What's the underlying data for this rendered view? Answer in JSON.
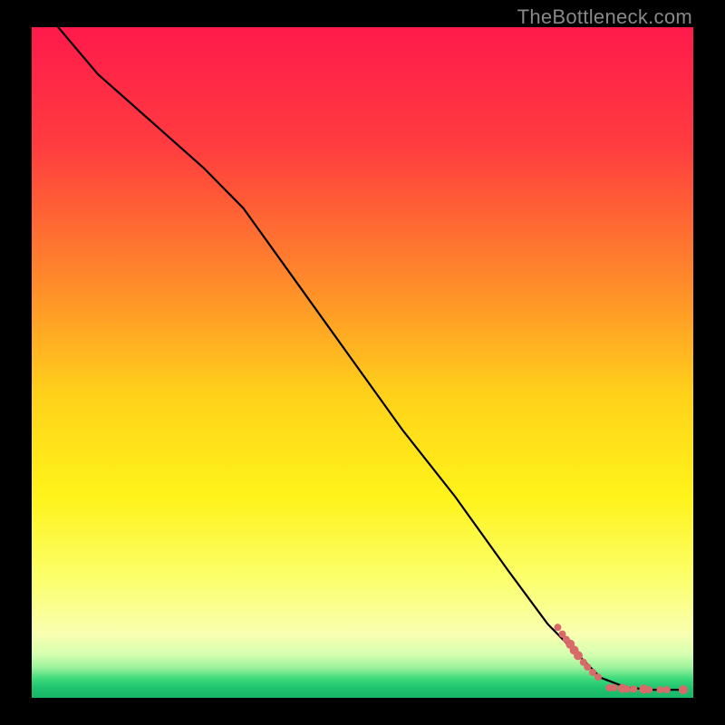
{
  "watermark": "TheBottleneck.com",
  "chart_data": {
    "type": "line",
    "title": "",
    "xlabel": "",
    "ylabel": "",
    "xlim": [
      0,
      100
    ],
    "ylim": [
      0,
      100
    ],
    "background_gradient": {
      "stops": [
        {
          "offset": 0.0,
          "color": "#ff1a4b"
        },
        {
          "offset": 0.18,
          "color": "#ff3d3f"
        },
        {
          "offset": 0.38,
          "color": "#ff8a2a"
        },
        {
          "offset": 0.55,
          "color": "#ffd21a"
        },
        {
          "offset": 0.7,
          "color": "#fff31a"
        },
        {
          "offset": 0.82,
          "color": "#fbff6a"
        },
        {
          "offset": 0.905,
          "color": "#f9ffb0"
        },
        {
          "offset": 0.935,
          "color": "#d6ffb0"
        },
        {
          "offset": 0.955,
          "color": "#9cf29c"
        },
        {
          "offset": 0.972,
          "color": "#3bd97a"
        },
        {
          "offset": 0.985,
          "color": "#1fc46f"
        },
        {
          "offset": 1.0,
          "color": "#17b768"
        }
      ]
    },
    "series": [
      {
        "name": "bottleneck-curve",
        "type": "line",
        "color": "#000000",
        "x": [
          4,
          10,
          18,
          26,
          32,
          40,
          48,
          56,
          64,
          72,
          78,
          83,
          86,
          90,
          94,
          99
        ],
        "y": [
          100,
          93,
          86,
          79,
          73,
          62,
          51,
          40,
          30,
          19,
          11,
          6,
          3,
          1.5,
          1.2,
          1.2
        ]
      },
      {
        "name": "data-points",
        "type": "scatter",
        "color": "#d86a6a",
        "points": [
          {
            "x": 79.5,
            "y": 10.5,
            "r": 4
          },
          {
            "x": 80.2,
            "y": 9.5,
            "r": 4
          },
          {
            "x": 80.8,
            "y": 8.7,
            "r": 4
          },
          {
            "x": 81.4,
            "y": 8.0,
            "r": 5
          },
          {
            "x": 82.0,
            "y": 7.1,
            "r": 5
          },
          {
            "x": 82.6,
            "y": 6.3,
            "r": 5
          },
          {
            "x": 83.4,
            "y": 5.3,
            "r": 4
          },
          {
            "x": 84.0,
            "y": 4.6,
            "r": 4
          },
          {
            "x": 84.8,
            "y": 3.8,
            "r": 4
          },
          {
            "x": 85.6,
            "y": 3.1,
            "r": 4
          },
          {
            "x": 87.3,
            "y": 1.5,
            "r": 4
          },
          {
            "x": 88.0,
            "y": 1.5,
            "r": 4
          },
          {
            "x": 89.3,
            "y": 1.4,
            "r": 5
          },
          {
            "x": 90.0,
            "y": 1.3,
            "r": 4
          },
          {
            "x": 91.0,
            "y": 1.3,
            "r": 4
          },
          {
            "x": 92.5,
            "y": 1.3,
            "r": 5
          },
          {
            "x": 93.3,
            "y": 1.2,
            "r": 4
          },
          {
            "x": 95.0,
            "y": 1.2,
            "r": 4
          },
          {
            "x": 96.0,
            "y": 1.2,
            "r": 4
          },
          {
            "x": 98.5,
            "y": 1.2,
            "r": 5
          }
        ]
      }
    ]
  }
}
